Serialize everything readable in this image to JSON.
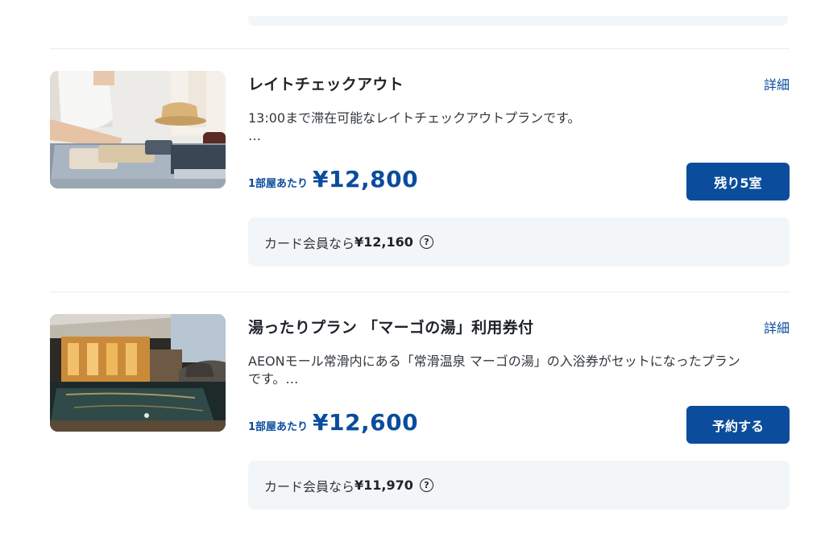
{
  "plans": [
    {
      "title": "レイトチェックアウト",
      "detail_link": "詳細",
      "description_line1": "13:00まで滞在可能なレイトチェックアウトプランです。",
      "description_line2": "…",
      "price_unit": "1部屋あたり",
      "price": "¥12,800",
      "button_label": "残り5室",
      "member_label": "カード会員なら",
      "member_price": "¥12,160",
      "help_icon": "?"
    },
    {
      "title": "湯ったりプラン 「マーゴの湯」利用券付",
      "detail_link": "詳細",
      "description_line1": "AEONモール常滑内にある「常滑温泉 マーゴの湯」の入浴券がセットになったプラン",
      "description_line2": "です。…",
      "price_unit": "1部屋あたり",
      "price": "¥12,600",
      "button_label": "予約する",
      "member_label": "カード会員なら",
      "member_price": "¥11,970",
      "help_icon": "?"
    }
  ],
  "icons": {
    "help": "question-circle-icon"
  },
  "colors": {
    "accent": "#0b4d9c",
    "link": "#0a4c9e",
    "panel": "#f3f6f8"
  }
}
